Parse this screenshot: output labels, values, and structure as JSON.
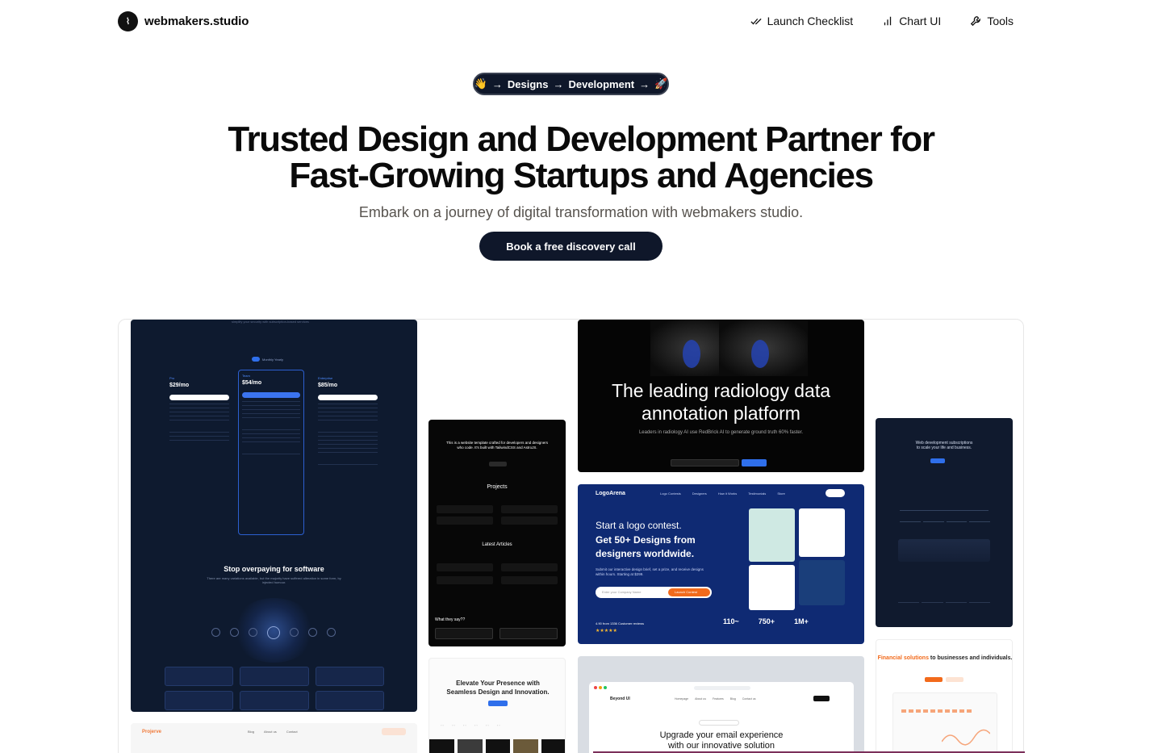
{
  "nav": {
    "brand": "webmakers.studio",
    "brand_icon": "waveform-logo-icon",
    "links": [
      {
        "label": "Launch Checklist",
        "icon": "checkmarks-icon"
      },
      {
        "label": "Chart UI",
        "icon": "bar-chart-icon"
      },
      {
        "label": "Tools",
        "icon": "wrench-icon"
      }
    ]
  },
  "pill": {
    "wave": "👋",
    "designs": "Designs",
    "development": "Development",
    "rocket": "🚀",
    "arrow": "→"
  },
  "hero": {
    "title_line1": "Trusted Design and Development Partner for",
    "title_line2": "Fast-Growing Startups and Agencies",
    "subtitle": "Embark on a journey of digital transformation with webmakers studio.",
    "cta": "Book a free discovery call"
  },
  "showcase": {
    "pricing": {
      "top_text": "simplify your security with subscription-based services",
      "toggle": "Monthly  Yearly",
      "plans": [
        {
          "name": "Pro",
          "price": "$29/mo"
        },
        {
          "name": "Team",
          "price": "$54/mo"
        },
        {
          "name": "Enterprise",
          "price": "$85/mo"
        }
      ],
      "headline": "Stop overpaying for software",
      "subline": "There are many variations available, but the majority have suffered alteration in some form, by injected humour."
    },
    "footer_logo": "Projerve",
    "footer_nav": [
      "Blog",
      "About us",
      "Contact"
    ],
    "dark_template": {
      "intro": "This is a website template crafted for developers and designers who code. It's built with TailwindCSS and AstroJS.",
      "projects": "Projects",
      "articles": "Latest Articles",
      "testimonials": "What they say??"
    },
    "light_hero": {
      "line1": "Elevate Your Presence with",
      "line2": "Seamless Design and Innovation."
    },
    "radiology": {
      "line1": "The leading radiology data",
      "line2": "annotation platform",
      "sub": "Leaders in radiology AI use RedBrick AI to generate ground truth 60% faster."
    },
    "logoarena": {
      "brand": "LogoArena",
      "nav": [
        "Logo Contests",
        "Designers",
        "How it Works",
        "Testimonials",
        "Store"
      ],
      "h1": "Start a logo contest.",
      "h2": "Get 50+ Designs from designers worldwide.",
      "p": "Submit our interactive design brief, set a prize, and receive designs within hours. Starting at $299.",
      "input": "Enter your Company Name",
      "button": "Launch Contest",
      "reviews": "4.90 from 1336 Customer reviews",
      "stars": "★★★★★",
      "stats": [
        "110~",
        "750+",
        "1M+"
      ]
    },
    "beyondui": {
      "brand": "Beyond UI",
      "nav": [
        "Homepage",
        "About us",
        "Features",
        "Blog",
        "Contact us"
      ],
      "line1": "Upgrade your email experience",
      "line2": "with our innovative solution"
    },
    "webdev": {
      "line1": "Web development subscriptions",
      "line2": "to scale your life and business."
    },
    "financial": {
      "accent": "Financial solutions",
      "rest": " to businesses and individuals."
    }
  },
  "colors": {
    "dark_navy": "#0f172a",
    "accent_blue": "#2f6feb",
    "accent_orange": "#f26a1b"
  }
}
